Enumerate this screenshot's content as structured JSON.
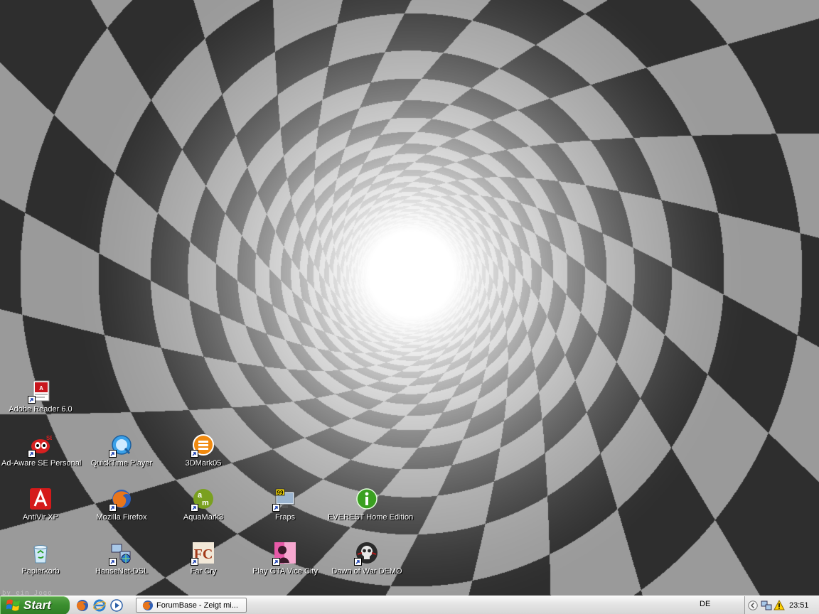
{
  "wallpaper": {
    "description_text": "by ein Jogo",
    "colors": {
      "dark": "#2e2e2e",
      "light": "#9a9a9a",
      "glow": "#ffffff"
    }
  },
  "desktop_icons": [
    {
      "label": "Adobe Reader 6.0",
      "icon": "adobe-reader-icon"
    },
    {
      "label": "Ad-Aware SE Personal",
      "icon": "ad-aware-icon"
    },
    {
      "label": "QuickTime Player",
      "icon": "quicktime-icon"
    },
    {
      "label": "3DMark05",
      "icon": "3dmark-icon"
    },
    {
      "label": "AntiVir XP",
      "icon": "antivir-icon"
    },
    {
      "label": "Mozilla Firefox",
      "icon": "firefox-icon"
    },
    {
      "label": "AquaMark3",
      "icon": "aquamark-icon"
    },
    {
      "label": "Fraps",
      "icon": "fraps-icon"
    },
    {
      "label": "EVEREST Home Edition",
      "icon": "everest-icon"
    },
    {
      "label": "Papierkorb",
      "icon": "recycle-bin-icon"
    },
    {
      "label": "HanseNet-DSL",
      "icon": "network-connection-icon"
    },
    {
      "label": "Far Cry",
      "icon": "far-cry-icon"
    },
    {
      "label": "Play GTA Vice City",
      "icon": "gta-vice-city-icon"
    },
    {
      "label": "Dawn of War DEMO",
      "icon": "dawn-of-war-icon"
    }
  ],
  "taskbar": {
    "start_label": "Start",
    "quick_launch": [
      "firefox-icon",
      "internet-explorer-icon",
      "media-player-icon"
    ],
    "task_button_label": "ForumBase - Zeigt mi...",
    "language": "DE",
    "clock": "23:51",
    "tray_icons": [
      "network-icon",
      "security-warning-icon"
    ]
  },
  "colors": {
    "start_green": "#3b8f2f",
    "taskbar_bg": "#e6e6e6"
  }
}
